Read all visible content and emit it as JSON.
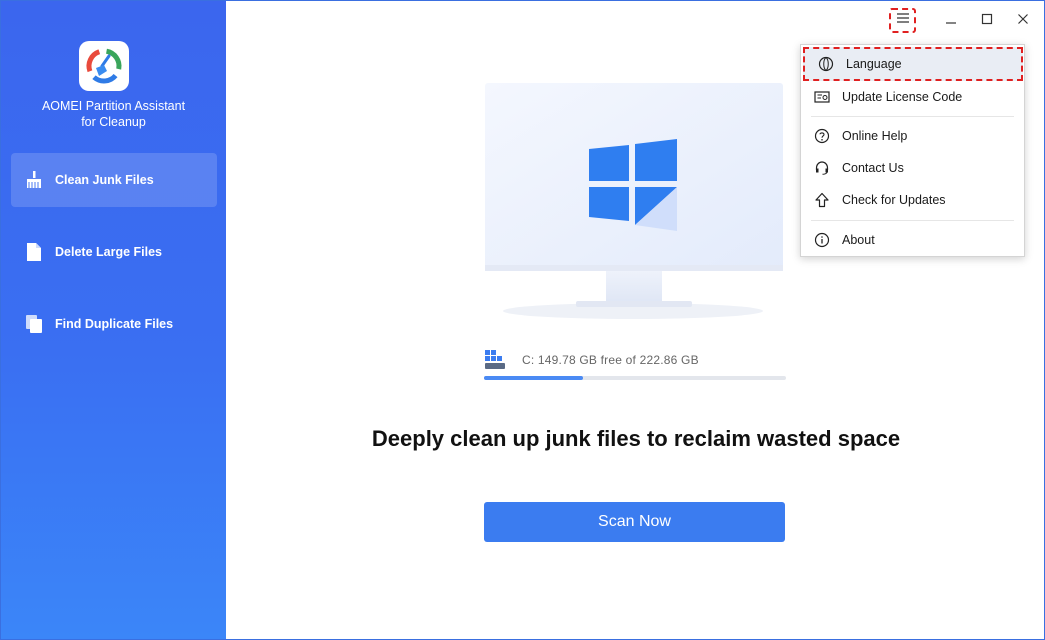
{
  "app": {
    "name_line1": "AOMEI Partition Assistant",
    "name_line2": "for Cleanup"
  },
  "sidebar": {
    "items": [
      {
        "label": "Clean Junk Files",
        "icon": "broom-icon",
        "active": true
      },
      {
        "label": "Delete Large Files",
        "icon": "file-icon",
        "active": false
      },
      {
        "label": "Find Duplicate Files",
        "icon": "duplicate-files-icon",
        "active": false
      }
    ]
  },
  "window_controls": {
    "menu": "menu-icon",
    "minimize": "minimize-icon",
    "maximize": "maximize-icon",
    "close": "close-icon"
  },
  "disk": {
    "label": "C: 149.78 GB free of 222.86 GB",
    "used_fraction": 0.328
  },
  "main": {
    "headline": "Deeply clean up junk files to reclaim wasted space",
    "scan_button": "Scan Now"
  },
  "dropdown": {
    "items": [
      {
        "label": "Language",
        "icon": "language-icon"
      },
      {
        "label": "Update License Code",
        "icon": "license-icon"
      },
      {
        "label": "Online Help",
        "icon": "help-icon"
      },
      {
        "label": "Contact Us",
        "icon": "headset-icon"
      },
      {
        "label": "Check for Updates",
        "icon": "upload-arrow-icon"
      },
      {
        "label": "About",
        "icon": "info-icon"
      }
    ]
  },
  "colors": {
    "sidebar_top": "#3b66ee",
    "sidebar_bottom": "#3b86f8",
    "accent": "#3b7cf0",
    "highlight_border": "#e02020"
  }
}
